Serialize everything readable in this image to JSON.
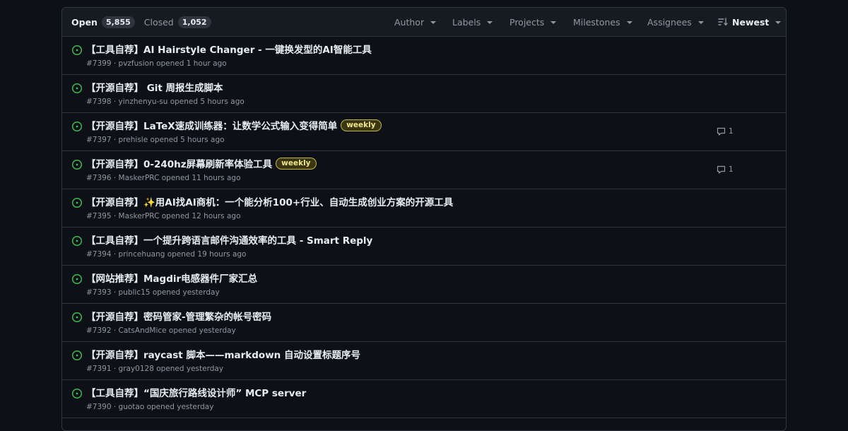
{
  "header": {
    "open_label": "Open",
    "open_count": "5,855",
    "closed_label": "Closed",
    "closed_count": "1,052",
    "filters": {
      "author": "Author",
      "labels": "Labels",
      "projects": "Projects",
      "milestones": "Milestones",
      "assignees": "Assignees",
      "sort": "Newest"
    }
  },
  "colors": {
    "open_icon": "#3fb950",
    "label_weekly": "#c2b54a"
  },
  "issues": [
    {
      "title": "【工具自荐】AI Hairstyle Changer - 一键换发型的AI智能工具",
      "meta": "#7399 · pvzfusion opened 1 hour ago",
      "label": "",
      "comments": ""
    },
    {
      "title": "【开源自荐】 Git 周报生成脚本",
      "meta": "#7398 · yinzhenyu-su opened 5 hours ago",
      "label": "",
      "comments": ""
    },
    {
      "title": "【开源自荐】LaTeX速成训练器：让数学公式输入变得简单",
      "meta": "#7397 · prehisle opened 5 hours ago",
      "label": "weekly",
      "comments": "1"
    },
    {
      "title": "【开源自荐】0-240hz屏幕刷新率体验工具",
      "meta": "#7396 · MaskerPRC opened 11 hours ago",
      "label": "weekly",
      "comments": "1"
    },
    {
      "title": "【开源自荐】✨用AI找AI商机：一个能分析100+行业、自动生成创业方案的开源工具",
      "meta": "#7395 · MaskerPRC opened 12 hours ago",
      "label": "",
      "comments": ""
    },
    {
      "title": "【工具自荐】一个提升跨语言邮件沟通效率的工具 - Smart Reply",
      "meta": "#7394 · princehuang opened 19 hours ago",
      "label": "",
      "comments": ""
    },
    {
      "title": "【网站推荐】Magdir电感器件厂家汇总",
      "meta": "#7393 · public15 opened yesterday",
      "label": "",
      "comments": ""
    },
    {
      "title": "【开源自荐】密码管家-管理繁杂的帐号密码",
      "meta": "#7392 · CatsAndMice opened yesterday",
      "label": "",
      "comments": ""
    },
    {
      "title": "【开源自荐】raycast 脚本——markdown 自动设置标题序号",
      "meta": "#7391 · gray0128 opened yesterday",
      "label": "",
      "comments": ""
    },
    {
      "title": "【工具自荐】“国庆旅行路线设计师” MCP server",
      "meta": "#7390 · guotao opened yesterday",
      "label": "",
      "comments": ""
    }
  ]
}
